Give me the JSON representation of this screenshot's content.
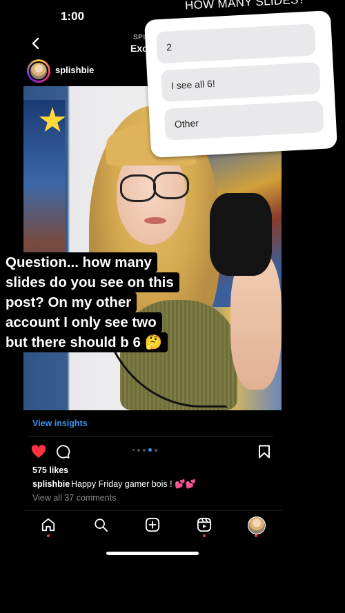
{
  "status_bar": {
    "time": "1:00"
  },
  "header": {
    "top_label": "SPL",
    "title": "Exc"
  },
  "post": {
    "username": "splishbie",
    "caption_overlay": [
      "Question... how many",
      "slides do you see on this",
      "post? On my other",
      "account I only see two",
      "but there should b 6 🤔"
    ],
    "insights_label": "View insights",
    "likes": "575 likes",
    "caption_user": "splishbie",
    "caption_text": "Happy Friday gamer bois ! 💕💕",
    "view_comments": "View all 37 comments",
    "carousel": {
      "total": 6,
      "active_index": 4
    }
  },
  "poll": {
    "title": "HOW MANY SLIDES?",
    "options": [
      "2",
      "I see all 6!",
      "Other"
    ]
  },
  "colors": {
    "accent": "#3897f0",
    "like": "#ff3040",
    "poll_bg": "#ffffff",
    "option_bg": "#e9e9eb"
  },
  "icons": {
    "back": "chevron-left-icon",
    "heart": "heart-filled-icon",
    "comment": "comment-icon",
    "bookmark": "bookmark-icon",
    "home": "home-icon",
    "search": "search-icon",
    "create": "plus-square-icon",
    "reels": "reels-icon"
  }
}
